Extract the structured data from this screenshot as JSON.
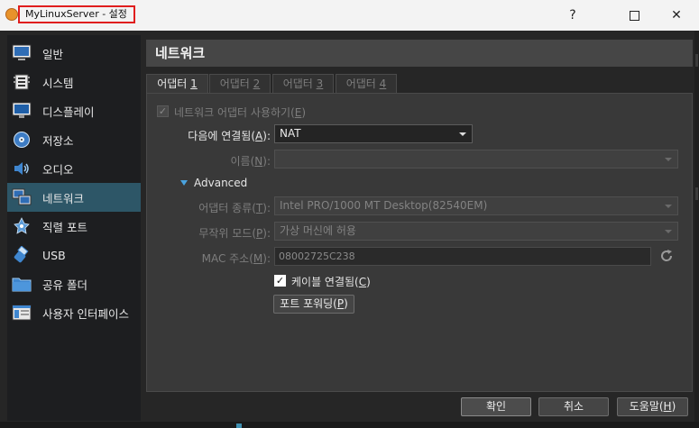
{
  "window": {
    "title": "MyLinuxServer - 설정",
    "help_glyph": "?",
    "close_glyph": "✕"
  },
  "sidebar": {
    "items": [
      {
        "label": "일반",
        "icon": "general-icon"
      },
      {
        "label": "시스템",
        "icon": "system-icon"
      },
      {
        "label": "디스플레이",
        "icon": "display-icon"
      },
      {
        "label": "저장소",
        "icon": "storage-icon"
      },
      {
        "label": "오디오",
        "icon": "audio-icon"
      },
      {
        "label": "네트워크",
        "icon": "network-icon",
        "active": true
      },
      {
        "label": "직렬 포트",
        "icon": "serial-port-icon"
      },
      {
        "label": "USB",
        "icon": "usb-icon"
      },
      {
        "label": "공유 폴더",
        "icon": "shared-folder-icon"
      },
      {
        "label": "사용자 인터페이스",
        "icon": "user-interface-icon"
      }
    ]
  },
  "main": {
    "section_title": "네트워크",
    "tabs": [
      {
        "label": "어댑터 ",
        "num": "1",
        "active": true
      },
      {
        "label": "어댑터 ",
        "num": "2"
      },
      {
        "label": "어댑터 ",
        "num": "3"
      },
      {
        "label": "어댑터 ",
        "num": "4"
      }
    ],
    "enable_adapter": {
      "label": "네트워크 어댑터 사용하기(",
      "key": "E",
      "suffix": ")",
      "check": "✓"
    },
    "attached_to": {
      "label": "다음에 연결됨(",
      "key": "A",
      "suffix": "):",
      "value": "NAT"
    },
    "name": {
      "label": "이름(",
      "key": "N",
      "suffix": "):",
      "value": ""
    },
    "advanced": {
      "label": "Advanced"
    },
    "adapter_type": {
      "label": "어댑터 종류(",
      "key": "T",
      "suffix": "):",
      "value": "Intel PRO/1000 MT Desktop(82540EM)"
    },
    "promiscuous": {
      "label": "무작위 모드(",
      "key": "P",
      "suffix": "):",
      "value": "가상 머신에 허용"
    },
    "mac": {
      "label": "MAC 주소(",
      "key": "M",
      "suffix": "):",
      "value": "08002725C238"
    },
    "cable": {
      "label": "케이블 연결됨(",
      "key": "C",
      "suffix": ")",
      "check": "✓"
    },
    "port_forwarding": {
      "label": "포트 포워딩(",
      "key": "P",
      "suffix": ")"
    }
  },
  "footer": {
    "ok": "확인",
    "cancel": "취소",
    "help": "도움말(",
    "help_key": "H",
    "help_suffix": ")"
  },
  "colors": {
    "background": "#262626",
    "sidebar": "#1d1e20",
    "active_item": "#2d5667",
    "title_highlight": "#e01e1e",
    "panel": "#393939"
  }
}
